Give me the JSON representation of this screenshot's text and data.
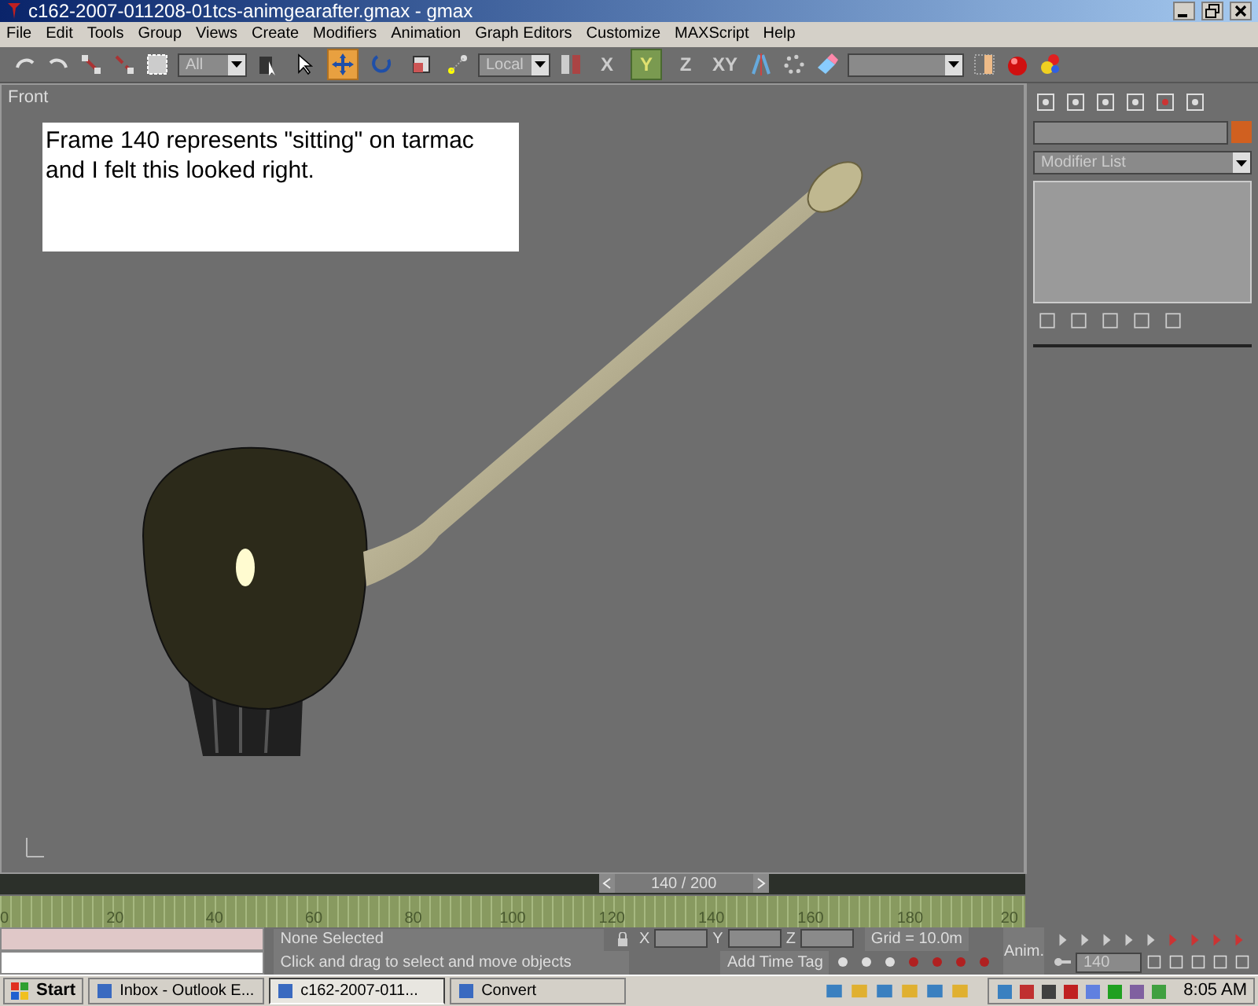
{
  "window": {
    "title": "c162-2007-011208-01tcs-animgearafter.gmax - gmax"
  },
  "menu": [
    "File",
    "Edit",
    "Tools",
    "Group",
    "Views",
    "Create",
    "Modifiers",
    "Animation",
    "Graph Editors",
    "Customize",
    "MAXScript",
    "Help"
  ],
  "toolbar": {
    "selection_filter": "All",
    "reference_coord": "Local",
    "tools": [
      {
        "kind": "select",
        "selected": false
      },
      {
        "kind": "move",
        "selected": true
      },
      {
        "kind": "rotate",
        "selected": false
      },
      {
        "kind": "scale",
        "selected": false
      }
    ],
    "constraints": [
      {
        "label": "X",
        "selected": false
      },
      {
        "label": "Y",
        "selected": true
      },
      {
        "label": "Z",
        "selected": false
      },
      {
        "label": "XY",
        "selected": false
      }
    ]
  },
  "viewport": {
    "label": "Front",
    "caption": "Frame 140 represents \"sitting\" on tarmac and I felt this looked right."
  },
  "command_panel": {
    "modifier_list": "Modifier List"
  },
  "time_slider": {
    "reading": "140 / 200",
    "level": 0.7,
    "ruler": [
      "0",
      "20",
      "40",
      "60",
      "80",
      "100",
      "120",
      "140",
      "160",
      "180",
      "20"
    ]
  },
  "status": {
    "selection": "None Selected",
    "prompt": "Click and drag to select and move objects",
    "axes": [
      "X",
      "Y",
      "Z"
    ],
    "grid": "Grid = 10.0m",
    "add_time_tag": "Add Time Tag",
    "anim": "Anim.",
    "frame": "140"
  },
  "taskbar": {
    "start": "Start",
    "tasks": [
      {
        "label": "Inbox - Outlook E...",
        "selected": false
      },
      {
        "label": "c162-2007-011...",
        "selected": true
      },
      {
        "label": "Convert",
        "selected": false
      }
    ],
    "clock": "8:05 AM"
  }
}
